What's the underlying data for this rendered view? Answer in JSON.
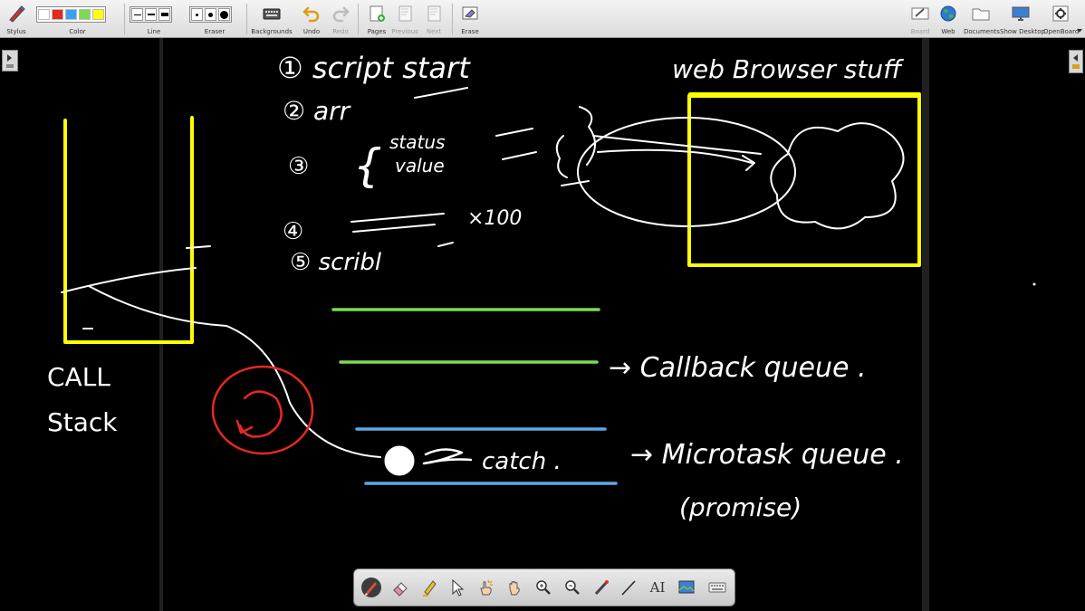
{
  "toolbar": {
    "stylus_label": "Stylus",
    "color_label": "Color",
    "line_label": "Line",
    "eraser_label": "Eraser",
    "backgrounds_label": "Backgrounds",
    "undo_label": "Undo",
    "redo_label": "Redo",
    "pages_label": "Pages",
    "previous_label": "Previous",
    "next_label": "Next",
    "erase_label": "Erase",
    "board_label": "Board",
    "web_label": "Web",
    "documents_label": "Documents",
    "show_desktop_label": "Show Desktop",
    "openboard_label": "OpenBoard",
    "palette_colors": [
      "#ffffff",
      "#e8281f",
      "#3ca0f0",
      "#7ed957",
      "#ffff00"
    ]
  },
  "board_text": {
    "step1": "① script start",
    "step2": "② arr",
    "step3_label": "③",
    "status": "status",
    "value": "value",
    "step4": "④",
    "times": "×100",
    "step5": "⑤ scribl",
    "web_browser": "web Browser stuff",
    "call": "CALL",
    "stack": "Stack",
    "callback_queue": "→ Callback queue .",
    "catch_text": "catch .",
    "microtask_queue": "→ Microtask queue .",
    "promise": "(promise)"
  },
  "palette": {
    "text_tool_label": "AI"
  },
  "colors": {
    "board_bg": "#000000",
    "ink_white": "#ffffff",
    "highlight_yellow": "#ffff00",
    "green_line": "#7ed957",
    "blue_line": "#5aa9e6",
    "red_circle": "#e8281f"
  }
}
